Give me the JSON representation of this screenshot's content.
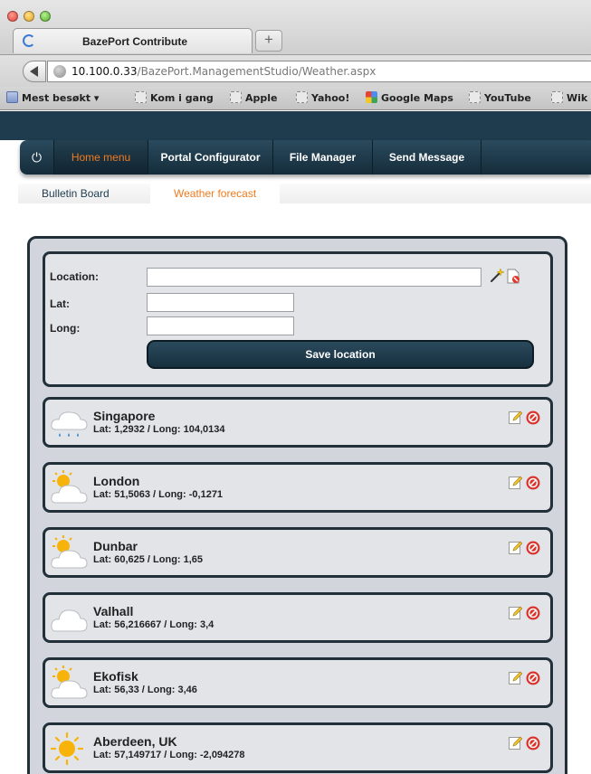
{
  "browser": {
    "tab_title": "BazePort Contribute",
    "url_host": "10.100.0.33",
    "url_path": "/BazePort.ManagementStudio/Weather.aspx",
    "new_tab_symbol": "+",
    "bookmarks": [
      "Mest besøkt ▾",
      "Kom i gang",
      "Apple",
      "Yahoo!",
      "Google Maps",
      "YouTube",
      "Wik"
    ]
  },
  "nav": {
    "power_symbol": "⏻",
    "items": [
      "Home menu",
      "Portal Configurator",
      "File Manager",
      "Send Message"
    ],
    "active": "Home menu",
    "active_color": "#f07a1e",
    "bar_color": "#1e3c4e"
  },
  "subnav": {
    "items": [
      "Bulletin Board",
      "Weather forecast"
    ],
    "active": "Weather forecast"
  },
  "form": {
    "location_label": "Location:",
    "lat_label": "Lat:",
    "long_label": "Long:",
    "location_value": "",
    "lat_value": "",
    "long_value": "",
    "save_label": "Save location"
  },
  "locations": [
    {
      "name": "Singapore",
      "coords": "Lat: 1,2932 / Long: 104,0134",
      "weather_icon": "rain-cloud-icon"
    },
    {
      "name": "London",
      "coords": "Lat: 51,5063 / Long: -0,1271",
      "weather_icon": "partly-cloudy-icon"
    },
    {
      "name": "Dunbar",
      "coords": "Lat: 60,625 / Long: 1,65",
      "weather_icon": "partly-cloudy-icon"
    },
    {
      "name": "Valhall",
      "coords": "Lat: 56,216667 / Long: 3,4",
      "weather_icon": "cloud-icon"
    },
    {
      "name": "Ekofisk",
      "coords": "Lat: 56,33 / Long: 3,46",
      "weather_icon": "partly-cloudy-icon"
    },
    {
      "name": "Aberdeen, UK",
      "coords": "Lat: 57,149717 / Long: -2,094278",
      "weather_icon": "sun-icon"
    }
  ]
}
